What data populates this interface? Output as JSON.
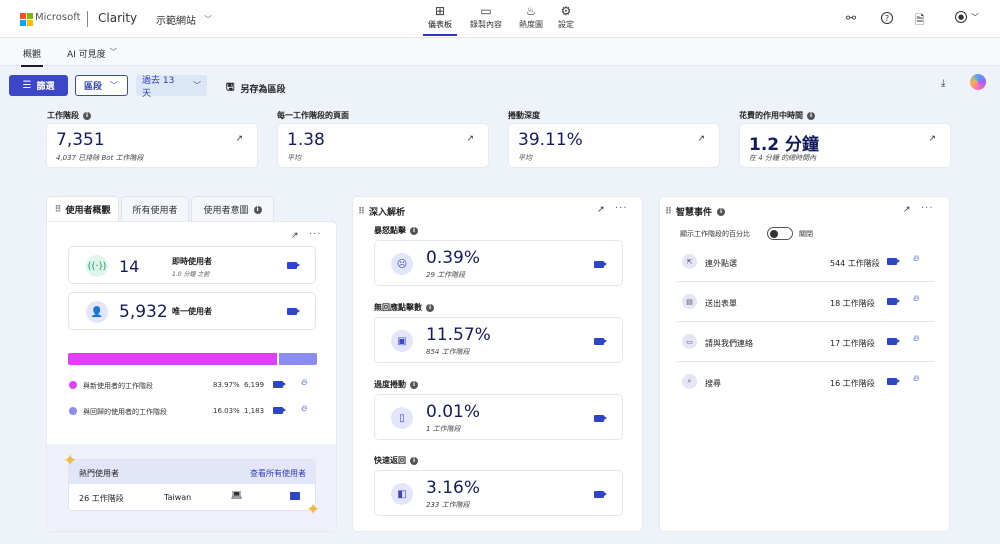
{
  "header": {
    "ms_label": "Microsoft",
    "app_name": "Clarity",
    "project_name": "示範網站",
    "nav": [
      {
        "label": "儀表板",
        "icon": "dashboard-icon"
      },
      {
        "label": "錄製內容",
        "icon": "video-icon"
      },
      {
        "label": "熱度圖",
        "icon": "flame-icon"
      },
      {
        "label": "設定",
        "icon": "gear-icon"
      }
    ]
  },
  "tabs": {
    "overview": "概觀",
    "ai": "AI 可見度"
  },
  "toolbar": {
    "filter": "篩選",
    "segment": "區段",
    "date_range": "過去 13 天",
    "save_segment": "另存為區段"
  },
  "metrics": [
    {
      "label": "工作階段",
      "value": "7,351",
      "sub": "4,037 已排除 Bot 工作階段"
    },
    {
      "label": "每一工作階段的頁面",
      "value": "1.38",
      "sub": "平均"
    },
    {
      "label": "捲動深度",
      "value": "39.11%",
      "sub": "平均"
    },
    {
      "label": "花費的作用中時間",
      "value": "1.2 分鐘",
      "sub": "在 4 分鐘 的總時間內"
    }
  ],
  "users_panel": {
    "tabs": [
      "使用者概觀",
      "所有使用者",
      "使用者意圖"
    ],
    "live": {
      "value": "14",
      "label": "即時使用者",
      "sub": "1.0 分鐘 之前"
    },
    "unique": {
      "value": "5,932",
      "label": "唯一使用者"
    },
    "bar": {
      "new_fraction": 0.8397,
      "new_color": "#e040fb",
      "returning_color": "#8c8cf0"
    },
    "legend": [
      {
        "label": "與新使用者的工作階段",
        "pct": "83.97%",
        "count": "6,199"
      },
      {
        "label": "與回歸的使用者的工作階段",
        "pct": "16.03%",
        "count": "1,183"
      }
    ],
    "top_users": {
      "title": "熱門使用者",
      "link": "查看所有使用者",
      "row": {
        "sessions": "26 工作階段",
        "country": "Taiwan"
      }
    }
  },
  "insights_panel": {
    "title": "深入解析",
    "items": [
      {
        "label": "暴怒點擊",
        "value": "0.39%",
        "sub": "29 工作階段",
        "icon": "angry-face-icon"
      },
      {
        "label": "無回應點擊數",
        "value": "11.57%",
        "sub": "854 工作階段",
        "icon": "dead-click-icon"
      },
      {
        "label": "過度捲動",
        "value": "0.01%",
        "sub": "1 工作階段",
        "icon": "scroll-icon"
      },
      {
        "label": "快速返回",
        "value": "3.16%",
        "sub": "233 工作階段",
        "icon": "quick-back-icon"
      }
    ]
  },
  "smart_panel": {
    "title": "智慧事件",
    "toggle_label": "顯示工作階段的百分比",
    "toggle_state": "關閉",
    "events": [
      {
        "name": "連外點選",
        "count": "544 工作階段"
      },
      {
        "name": "送出表單",
        "count": "18 工作階段"
      },
      {
        "name": "請與我們連絡",
        "count": "17 工作階段"
      },
      {
        "name": "搜尋",
        "count": "16 工作階段"
      }
    ]
  }
}
